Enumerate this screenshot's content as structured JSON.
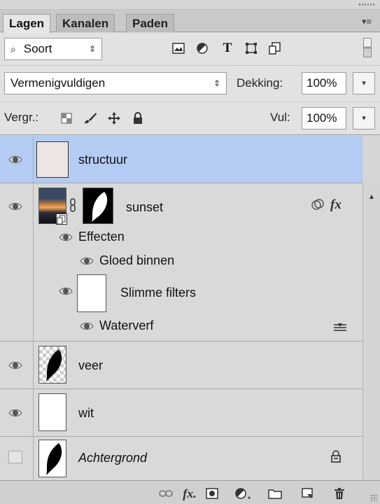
{
  "tabs": [
    "Lagen",
    "Kanalen",
    "Paden"
  ],
  "filter": {
    "kind_label": "Soort"
  },
  "blend": {
    "mode": "Vermenigvuldigen",
    "opacity_label": "Dekking:",
    "opacity_value": "100%",
    "fill_label": "Vul:",
    "fill_value": "100%"
  },
  "lock": {
    "label": "Vergr.:"
  },
  "layers": [
    {
      "name": "structuur",
      "selected": true
    },
    {
      "name": "sunset",
      "effects_label": "Effecten",
      "effect_item": "Gloed binnen",
      "smart_filters_label": "Slimme filters",
      "filter_item": "Waterverf"
    },
    {
      "name": "veer"
    },
    {
      "name": "wit"
    },
    {
      "name": "Achtergrond"
    }
  ],
  "colors": {
    "selected_row": "#b4ccf3",
    "panel": "#d9d9d9"
  }
}
